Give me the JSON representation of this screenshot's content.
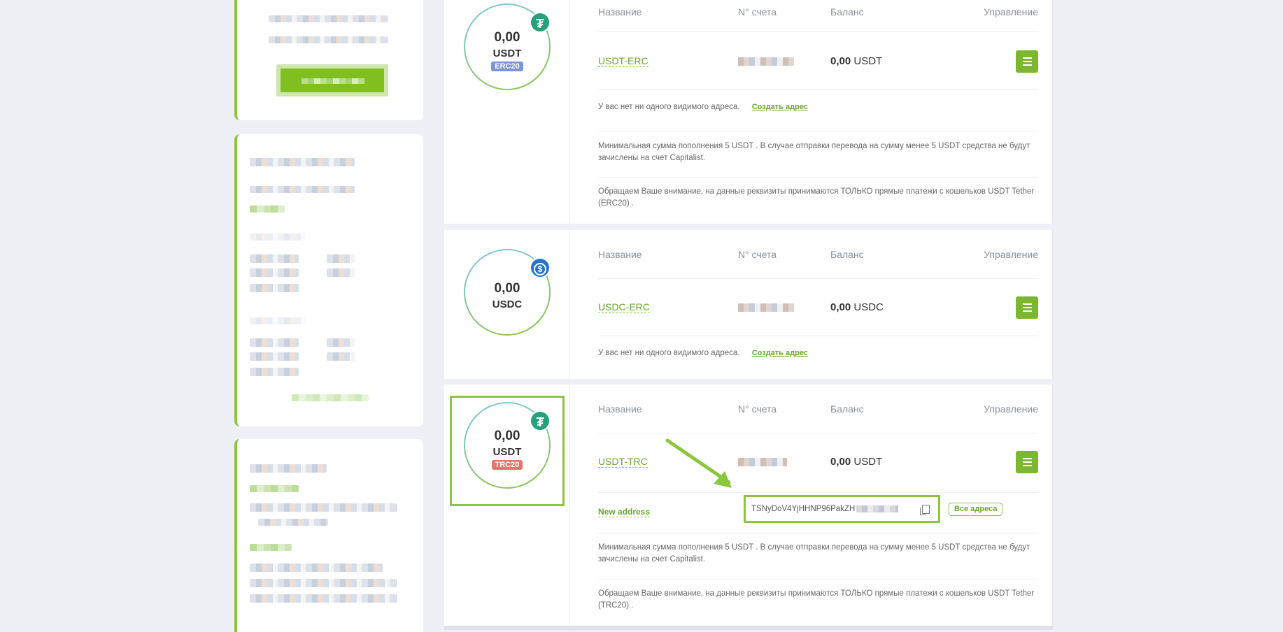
{
  "headers": {
    "name": "Название",
    "account": "N° счета",
    "balance": "Баланс",
    "control": "Управление"
  },
  "wallets": [
    {
      "amount": "0,00",
      "currency": "USDT",
      "network": "ERC20",
      "name": "USDT-ERC",
      "balance_value": "0,00",
      "balance_currency": "USDT",
      "no_address": "У вас нет ни одного видимого адреса.",
      "create_link": "Создать адрес",
      "min_note": "Минимальная сумма пополнения 5 USDT . В случае отправки перевода на сумму менее 5 USDT средства не будут зачислены на счет Capitalist.",
      "attention_note": "Обращаем Ваше внимание, на данные реквизиты принимаются ТОЛЬКО прямые платежи с кошельков USDT Tether (ERC20) ."
    },
    {
      "amount": "0,00",
      "currency": "USDC",
      "name": "USDC-ERC",
      "balance_value": "0,00",
      "balance_currency": "USDC",
      "no_address": "У вас нет ни одного видимого адреса.",
      "create_link": "Создать адрес"
    },
    {
      "amount": "0,00",
      "currency": "USDT",
      "network": "TRC20",
      "name": "USDT-TRC",
      "balance_value": "0,00",
      "balance_currency": "USDT",
      "new_address_label": "New address",
      "address": "TSNyDoV4YjHHNP96PakZH",
      "all_addresses": "Все адреса",
      "min_note": "Минимальная сумма пополнения 5 USDT . В случае отправки перевода на сумму менее 5 USDT средства не будут зачислены на счет Capitalist.",
      "attention_note": "Обращаем Ваше внимание, на данные реквизиты принимаются ТОЛЬКО прямые платежи с кошельков USDT Tether (TRC20) ."
    }
  ],
  "icons": {
    "tether": "tether-icon",
    "usdc": "usdc-icon",
    "menu": "hamburger-menu-icon",
    "copy": "copy-icon"
  },
  "colors": {
    "accent": "#8cc63f",
    "tether": "#26a17b",
    "usdc": "#2775ca",
    "erc_tag": "#7b95d8",
    "trc_tag": "#e5766b"
  }
}
